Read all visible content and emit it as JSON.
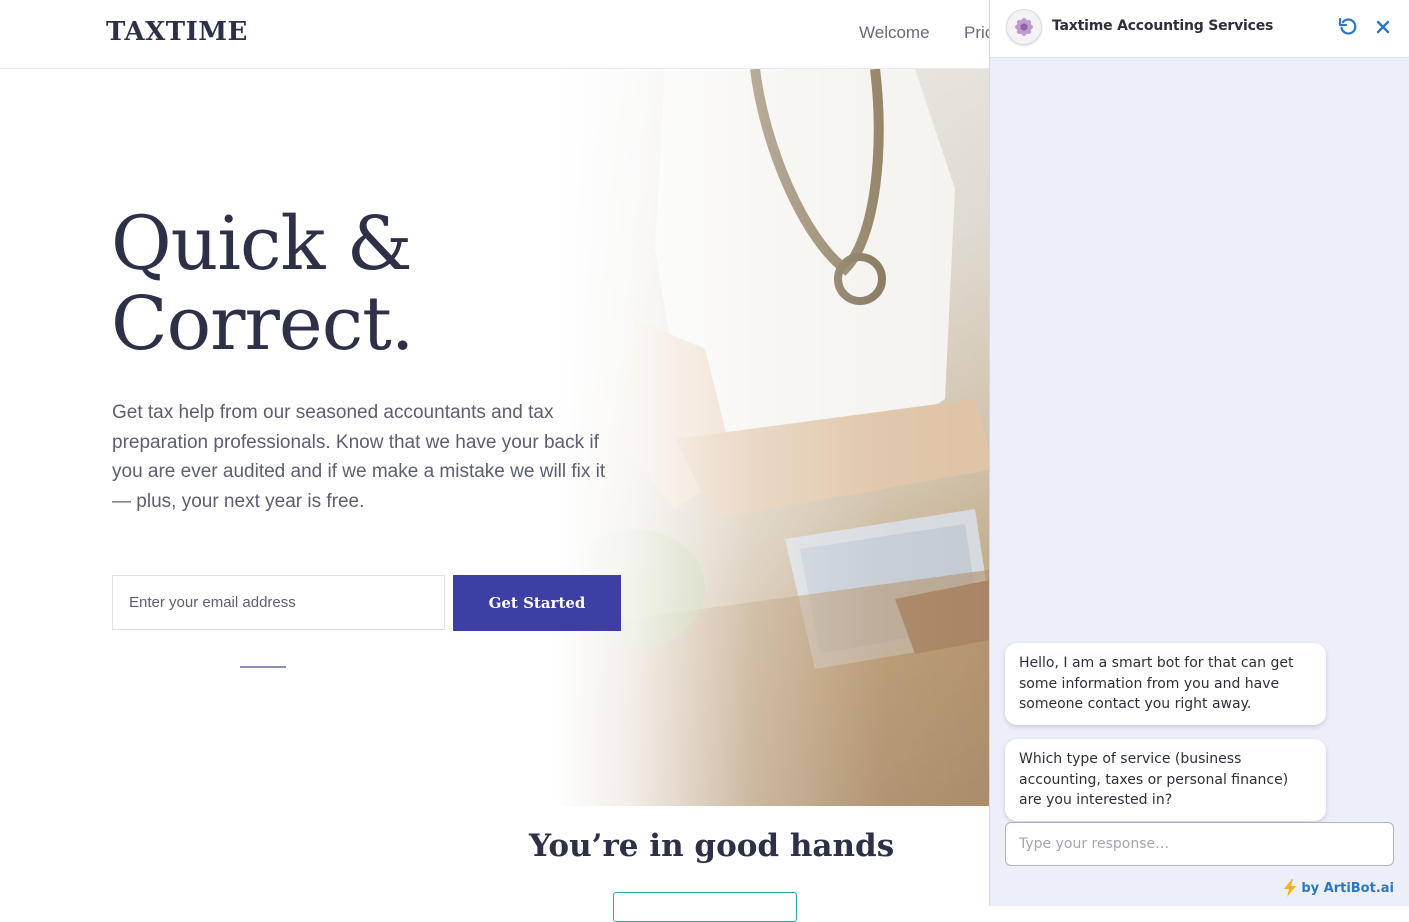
{
  "header": {
    "logo": "TAXTIME",
    "nav": [
      "Welcome",
      "Pric"
    ]
  },
  "hero": {
    "title_line1": "Quick &",
    "title_line2": "Correct.",
    "text": "Get tax help from our seasoned accountants and tax preparation professionals. Know that we have your back if you are ever audited and if we make a mistake we will fix it — plus, your next year is free.",
    "email_placeholder": "Enter your email address",
    "cta_label": "Get Started"
  },
  "section": {
    "title": "You’re in good hands"
  },
  "chat": {
    "title": "Taxtime Accounting Services",
    "messages": [
      "Hello, I am a smart bot for that can get some information from you and have someone contact you right away.",
      "Which type of service (business accounting, taxes or personal finance) are you interested in?"
    ],
    "input_placeholder": "Type your response…",
    "powered_by": "by ArtiBot.ai",
    "colors": {
      "accent": "#2b78c2",
      "background": "#eceef9",
      "cta": "#3d3fa5"
    }
  }
}
